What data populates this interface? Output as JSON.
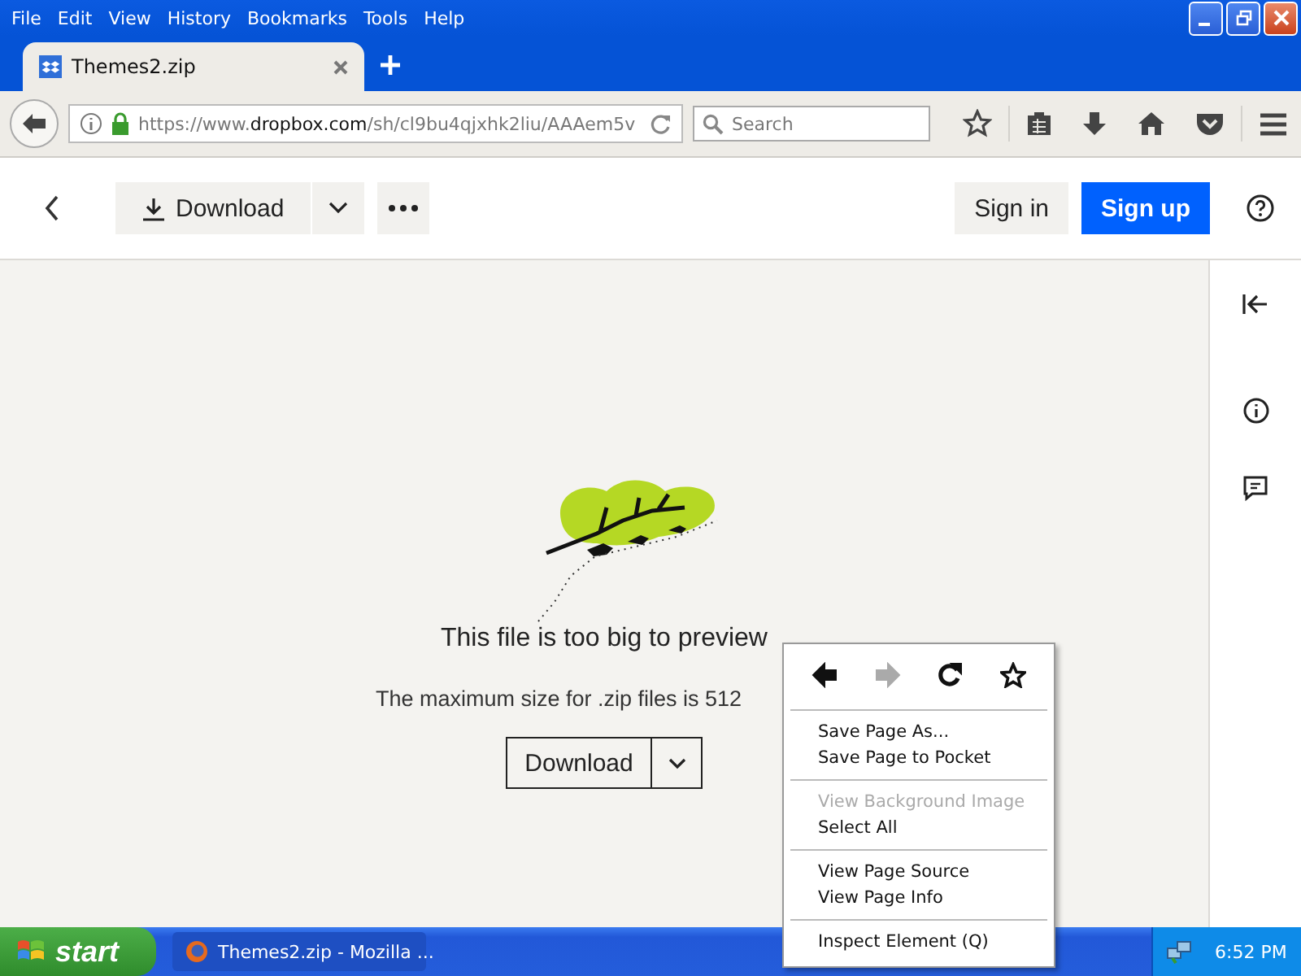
{
  "menubar": [
    "File",
    "Edit",
    "View",
    "History",
    "Bookmarks",
    "Tools",
    "Help"
  ],
  "tabs": [
    {
      "title": "Themes2.zip",
      "selected": true
    }
  ],
  "address_bar": {
    "scheme": "https://www.",
    "domain": "dropbox.com",
    "path": "/sh/cl9bu4qjxhk2liu/AAAem5v"
  },
  "search": {
    "placeholder": "Search"
  },
  "header": {
    "download": "Download",
    "sign_in": "Sign in",
    "sign_up": "Sign up"
  },
  "preview": {
    "title": "This file is too big to preview",
    "message": "The maximum size for .zip files is 512",
    "button": "Download"
  },
  "context_menu": {
    "nav": [
      {
        "kind": "back",
        "disabled": false
      },
      {
        "kind": "forward",
        "disabled": true
      },
      {
        "kind": "reload",
        "disabled": false
      },
      {
        "kind": "bookmark",
        "disabled": false
      }
    ],
    "groups": [
      [
        {
          "label": "Save Page As...",
          "disabled": false
        },
        {
          "label": "Save Page to Pocket",
          "disabled": false
        }
      ],
      [
        {
          "label": "View Background Image",
          "disabled": true
        },
        {
          "label": "Select All",
          "disabled": false
        }
      ],
      [
        {
          "label": "View Page Source",
          "disabled": false
        },
        {
          "label": "View Page Info",
          "disabled": false
        }
      ],
      [
        {
          "label": "Inspect Element (Q)",
          "disabled": false
        }
      ]
    ]
  },
  "taskbar": {
    "start": "start",
    "task": "Themes2.zip - Mozilla ...",
    "time": "6:52 PM"
  }
}
